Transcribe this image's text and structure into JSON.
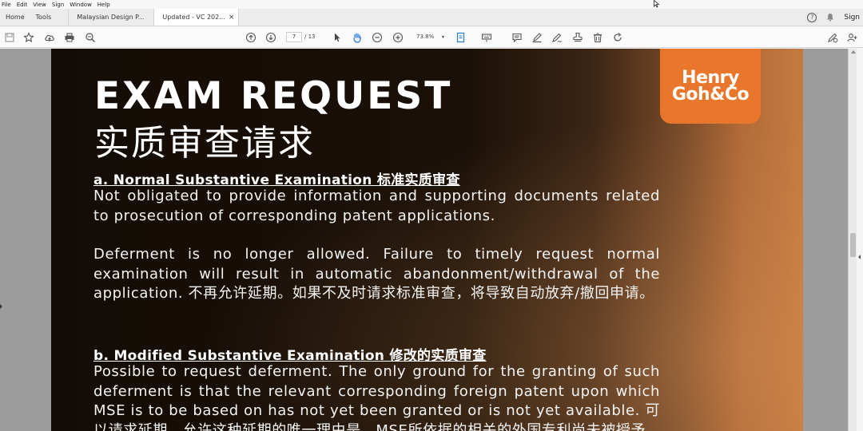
{
  "menu": [
    "File",
    "Edit",
    "View",
    "Sign",
    "Window",
    "Help"
  ],
  "tabs": {
    "home": "Home",
    "tools": "Tools",
    "doc1": "Malaysian Design P...",
    "doc2": "Updated - VC 202...",
    "close": "×",
    "sign": "Sign"
  },
  "toolbar": {
    "page_current": "7",
    "page_total": "/ 13",
    "zoom": "73.8%",
    "zoom_dd": "▾"
  },
  "document": {
    "title_en": "EXAM REQUEST",
    "title_zh": "实质审查请求",
    "logo_line1": "Henry",
    "logo_line2": "Goh&Co",
    "section_a_heading": "a. Normal Substantive Examination 标准实质审查",
    "section_a_p1": "Not obligated to provide information and supporting documents related to prosecution of corresponding patent applications.",
    "section_a_p2": "Deferment is no longer allowed. Failure to timely request normal examination will result in automatic abandonment/withdrawal of the application. 不再允许延期。如果不及时请求标准审查，将导致自动放弃/撤回申请。",
    "section_b_heading": "b. Modified Substantive Examination 修改的实质审查",
    "section_b_p1": "Possible to request deferment. The only ground for the granting of such deferment is that the relevant corresponding foreign patent upon which MSE is to be based on has not yet been granted or is not yet available. 可以请求延期。允许这种延期的唯一理由是，MSE所依据的相关的外国专利尚未被授予"
  }
}
